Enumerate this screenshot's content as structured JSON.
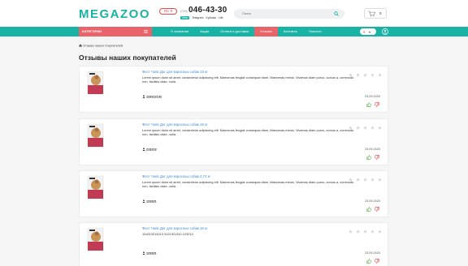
{
  "header": {
    "logo": "MEGAZOO",
    "language": "RU ▾",
    "city_code": "(056)",
    "phone": "046-43-30",
    "messengers": [
      "Viber",
      "Telegram",
      "Kyivstar",
      "Life"
    ],
    "search_placeholder": "Поиск",
    "cart_count": "0"
  },
  "nav": {
    "catalog_label": "Категории",
    "items": [
      {
        "label": "О компании",
        "active": false
      },
      {
        "label": "Акции",
        "active": false
      },
      {
        "label": "Оплата и доставка",
        "active": false
      },
      {
        "label": "Отзывы",
        "active": true
      },
      {
        "label": "Контакты",
        "active": false
      },
      {
        "label": "Новости",
        "active": false
      }
    ],
    "pill_heart": "♥",
    "pill_chevron": "▾"
  },
  "breadcrumb": "Отзывы наших покупателей",
  "page_title": "Отзывы наших покупателей",
  "reviews": [
    {
      "title": "Фест Чойс Дог для взрослых собак 15 кг",
      "text": "Lorem ipsum dolor sit amet, consectetur adipiscing elit. Maecenas feugiat consequat diam. Maecenas metus. Vivamus diam purus, cursus a, commodo non, facilisis vitae, nulla.",
      "user": "123212132",
      "date": "23.09.2020",
      "rating": 0
    },
    {
      "title": "Фест Чойс Дог для взрослых собак 15 кг",
      "text": "Lorem ipsum dolor sit amet, consectetur adipiscing elit. Maecenas feugiat consequat diam. Maecenas metus. Vivamus diam purus, cursus a, commodo non, facilisis vitae, nulla.",
      "user": "213213",
      "date": "23.09.2020",
      "rating": 0
    },
    {
      "title": "Фест Чойс Дог для взрослых собак 2,72 кг",
      "text": "Lorem ipsum dolor sit amet, consectetur adipiscing elit. Maecenas feugiat consequat diam. Maecenas metus. Vivamus diam purus, cursus a, commodo non, facilisis vitae, nulla.",
      "user": "123321",
      "date": "23.09.2020",
      "rating": 0
    },
    {
      "title": "Фест Чойс Дог для взрослых собак 15 кг",
      "text": "12d213213213 3121321312 123212",
      "user": "123321",
      "date": "23.09.2020",
      "rating": 0
    }
  ],
  "colors": {
    "teal": "#19b3a6",
    "coral": "#e8636a",
    "link": "#3a8bd9",
    "star_empty": "#d5d5d5",
    "like": "#5cb85c",
    "dislike": "#e64b4b"
  }
}
